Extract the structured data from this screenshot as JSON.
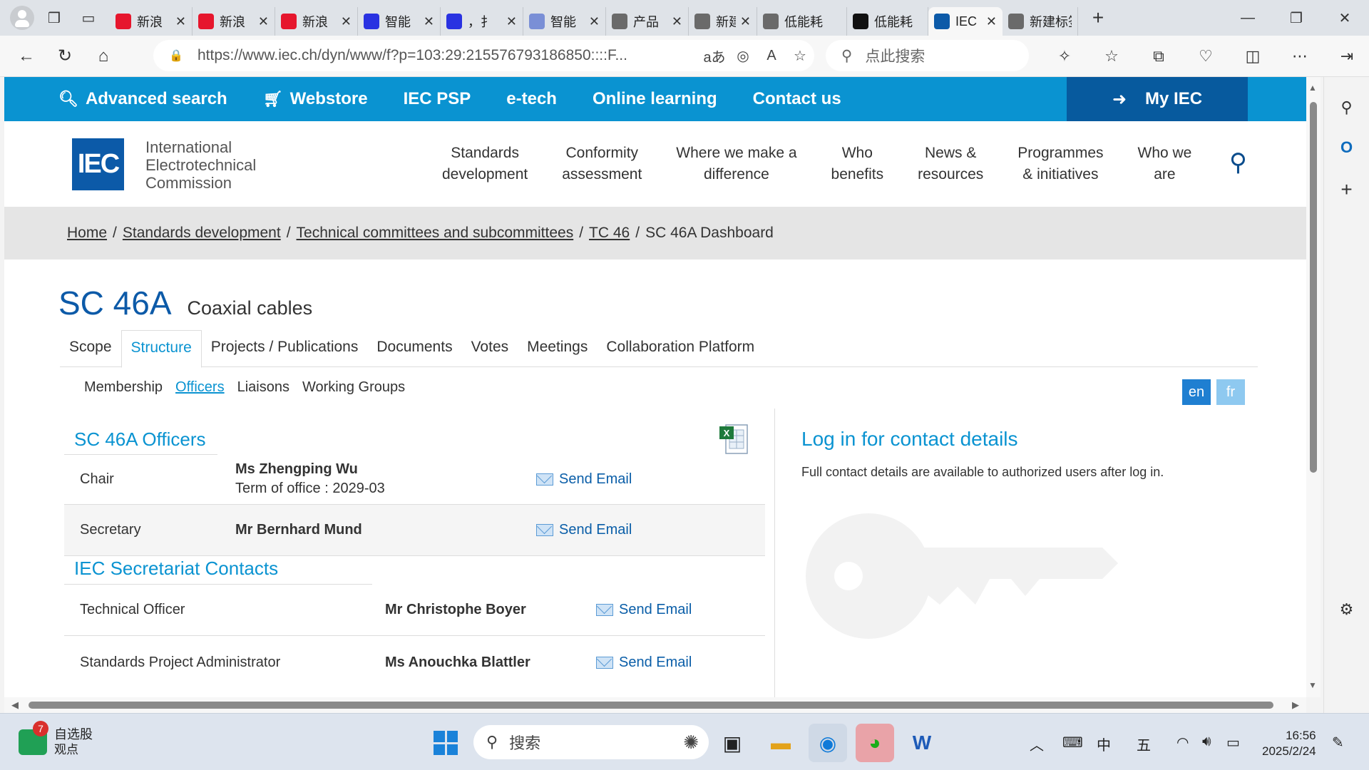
{
  "browser": {
    "tabs": [
      {
        "label": "新浪",
        "fav": "weibo-icon",
        "color": "#e6162d"
      },
      {
        "label": "新浪",
        "fav": "weibo-icon",
        "color": "#e6162d"
      },
      {
        "label": "新浪",
        "fav": "weibo-icon",
        "color": "#e6162d"
      },
      {
        "label": "智能",
        "fav": "baidu-icon",
        "color": "#2932e1"
      },
      {
        "label": "，扌",
        "fav": "baidu-icon",
        "color": "#2932e1"
      },
      {
        "label": "智能",
        "fav": "baidu-icon",
        "color": "#7a8fd6"
      },
      {
        "label": "产品",
        "fav": "doc-icon",
        "color": "#6a6a6a"
      },
      {
        "label": "新建",
        "fav": "page-icon",
        "color": "#6a6a6a"
      },
      {
        "label": "低能耗",
        "fav": "search-icon",
        "color": "#6a6a6a"
      },
      {
        "label": "低能耗",
        "fav": "k-icon",
        "color": "#111111"
      },
      {
        "label": "IEC",
        "fav": "iec-icon",
        "color": "#0c5aa8"
      },
      {
        "label": "新建标签",
        "fav": "page-icon",
        "color": "#6a6a6a"
      }
    ],
    "url": "https://www.iec.ch/dyn/www/f?p=103:29:215576793186850::::F...",
    "search_placeholder": "点此搜索"
  },
  "topnav": {
    "items": [
      "Advanced search",
      "Webstore",
      "IEC PSP",
      "e-tech",
      "Online learning",
      "Contact us"
    ],
    "my_iec": "My IEC"
  },
  "header": {
    "logo": "IEC",
    "org_lines": [
      "International",
      "Electrotechnical",
      "Commission"
    ],
    "menu": [
      [
        "Standards",
        "development"
      ],
      [
        "Conformity",
        "assessment"
      ],
      [
        "Where we make a",
        "difference"
      ],
      [
        "Who",
        "benefits"
      ],
      [
        "News &",
        "resources"
      ],
      [
        "Programmes",
        "& initiatives"
      ],
      [
        "Who we",
        "are"
      ]
    ]
  },
  "breadcrumb": {
    "links": [
      "Home",
      "Standards development",
      "Technical committees and subcommittees",
      "TC 46"
    ],
    "current": "SC 46A Dashboard"
  },
  "committee": {
    "code": "SC 46A",
    "name": "Coaxial cables"
  },
  "tabs": [
    "Scope",
    "Structure",
    "Projects / Publications",
    "Documents",
    "Votes",
    "Meetings",
    "Collaboration Platform"
  ],
  "subtabs": [
    "Membership",
    "Officers",
    "Liaisons",
    "Working Groups"
  ],
  "lang": [
    "en",
    "fr"
  ],
  "officers": {
    "title": "SC 46A Officers",
    "rows": [
      {
        "role": "Chair",
        "name": "Ms Zhengping Wu",
        "term": "Term of office : 2029-03",
        "action": "Send Email"
      },
      {
        "role": "Secretary",
        "name": "Mr Bernhard Mund",
        "term": "",
        "action": "Send Email"
      }
    ]
  },
  "secretariat": {
    "title": "IEC Secretariat Contacts",
    "rows": [
      {
        "role": "Technical Officer",
        "name": "Mr Christophe Boyer",
        "action": "Send Email"
      },
      {
        "role": "Standards Project Administrator",
        "name": "Ms Anouchka Blattler",
        "action": "Send Email"
      }
    ]
  },
  "login": {
    "title": "Log in for contact details",
    "text": "Full contact details are available to authorized users after log in."
  },
  "taskbar": {
    "stock_name": "自选股",
    "stock_sub": "观点",
    "badge": "7",
    "search": "搜索",
    "ime1": "中",
    "ime2": "五",
    "time": "16:56",
    "date": "2025/2/24"
  }
}
